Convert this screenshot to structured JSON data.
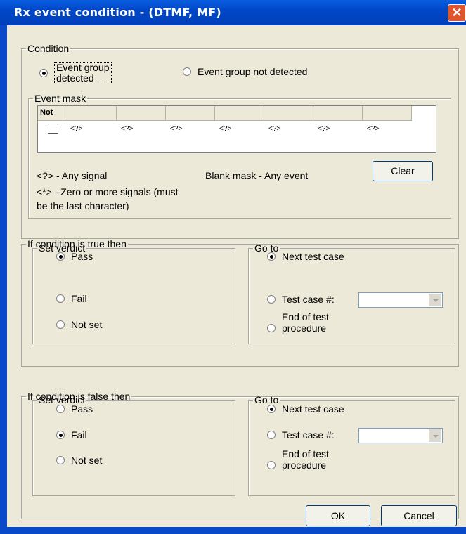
{
  "window": {
    "title": "Rx event condition - (DTMF, MF)",
    "close_glyph": "✕"
  },
  "condition": {
    "legend": "Condition",
    "detected_label_1": "Event group",
    "detected_label_2": "detected",
    "not_detected_label": "Event group not detected",
    "selected": "detected"
  },
  "event_mask": {
    "legend": "Event mask",
    "not_header": "Not",
    "cells": [
      "<?>",
      "<?>",
      "<?>",
      "<?>",
      "<?>",
      "<?>",
      "<?>"
    ],
    "not_checked": false,
    "hint_any_signal": "<?> - Any signal",
    "hint_blank_mask": "Blank mask - Any event",
    "hint_zero_more_1": "<*> - Zero or more signals (must",
    "hint_zero_more_2": "be the last character)",
    "clear_label": "Clear"
  },
  "true_section": {
    "legend": "If condition is true then",
    "verdict_legend": "Set verdict",
    "pass": "Pass",
    "fail": "Fail",
    "not_set": "Not set",
    "verdict_selected": "Pass",
    "goto_legend": "Go to",
    "next_test_case": "Next test case",
    "test_case_num": "Test case #:",
    "end_proc_1": "End of test",
    "end_proc_2": "procedure",
    "goto_selected": "Next test case",
    "test_case_value": ""
  },
  "false_section": {
    "legend": "If condition is false then",
    "verdict_legend": "Set verdict",
    "pass": "Pass",
    "fail": "Fail",
    "not_set": "Not set",
    "verdict_selected": "Fail",
    "goto_legend": "Go to",
    "next_test_case": "Next test case",
    "test_case_num": "Test case #:",
    "end_proc_1": "End of test",
    "end_proc_2": "procedure",
    "goto_selected": "Next test case",
    "test_case_value": ""
  },
  "buttons": {
    "ok": "OK",
    "cancel": "Cancel"
  }
}
